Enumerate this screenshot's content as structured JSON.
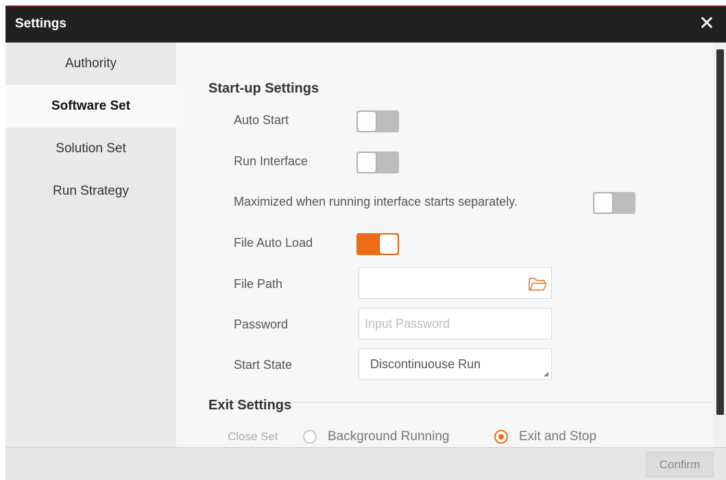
{
  "window": {
    "title": "Settings",
    "close_icon": "close-icon"
  },
  "sidebar": {
    "items": [
      {
        "label": "Authority",
        "active": false
      },
      {
        "label": "Software Set",
        "active": true
      },
      {
        "label": "Solution Set",
        "active": false
      },
      {
        "label": "Run Strategy",
        "active": false
      }
    ]
  },
  "startup": {
    "title": "Start-up Settings",
    "auto_start": {
      "label": "Auto Start",
      "on": false
    },
    "run_interface": {
      "label": "Run Interface",
      "on": false
    },
    "maximized": {
      "label": "Maximized when running interface starts separately.",
      "on": false
    },
    "file_auto_load": {
      "label": "File Auto Load",
      "on": true
    },
    "file_path": {
      "label": "File Path",
      "value": "",
      "placeholder": ""
    },
    "password": {
      "label": "Password",
      "value": "",
      "placeholder": "Input Password"
    },
    "start_state": {
      "label": "Start State",
      "value": "Discontinuouse Run"
    }
  },
  "exit": {
    "title": "Exit Settings",
    "close_set_label": "Close Set",
    "options": [
      {
        "label": "Background Running",
        "checked": false
      },
      {
        "label": "Exit and Stop",
        "checked": true
      }
    ]
  },
  "footer": {
    "confirm_label": "Confirm"
  },
  "colors": {
    "accent": "#ef6c16",
    "titlebar": "#212121",
    "sidebar": "#e9e9e9"
  }
}
